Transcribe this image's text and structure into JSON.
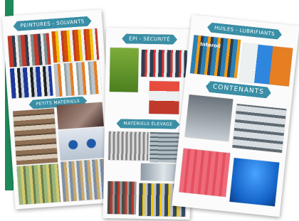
{
  "colors": {
    "accent_bar": "#1d8a5a",
    "banner": "#3a8fa6",
    "banner_text": "#ffffff"
  },
  "sheets": [
    {
      "banners": [
        "Peintures - Solvants",
        "Petits matériels"
      ]
    },
    {
      "banners": [
        "EPI - Sécurité",
        "Matériels élevage"
      ]
    },
    {
      "banners": [
        "Huiles - Lubrifiants",
        "Contenants"
      ],
      "brand_on_photo": "Interoil"
    }
  ]
}
